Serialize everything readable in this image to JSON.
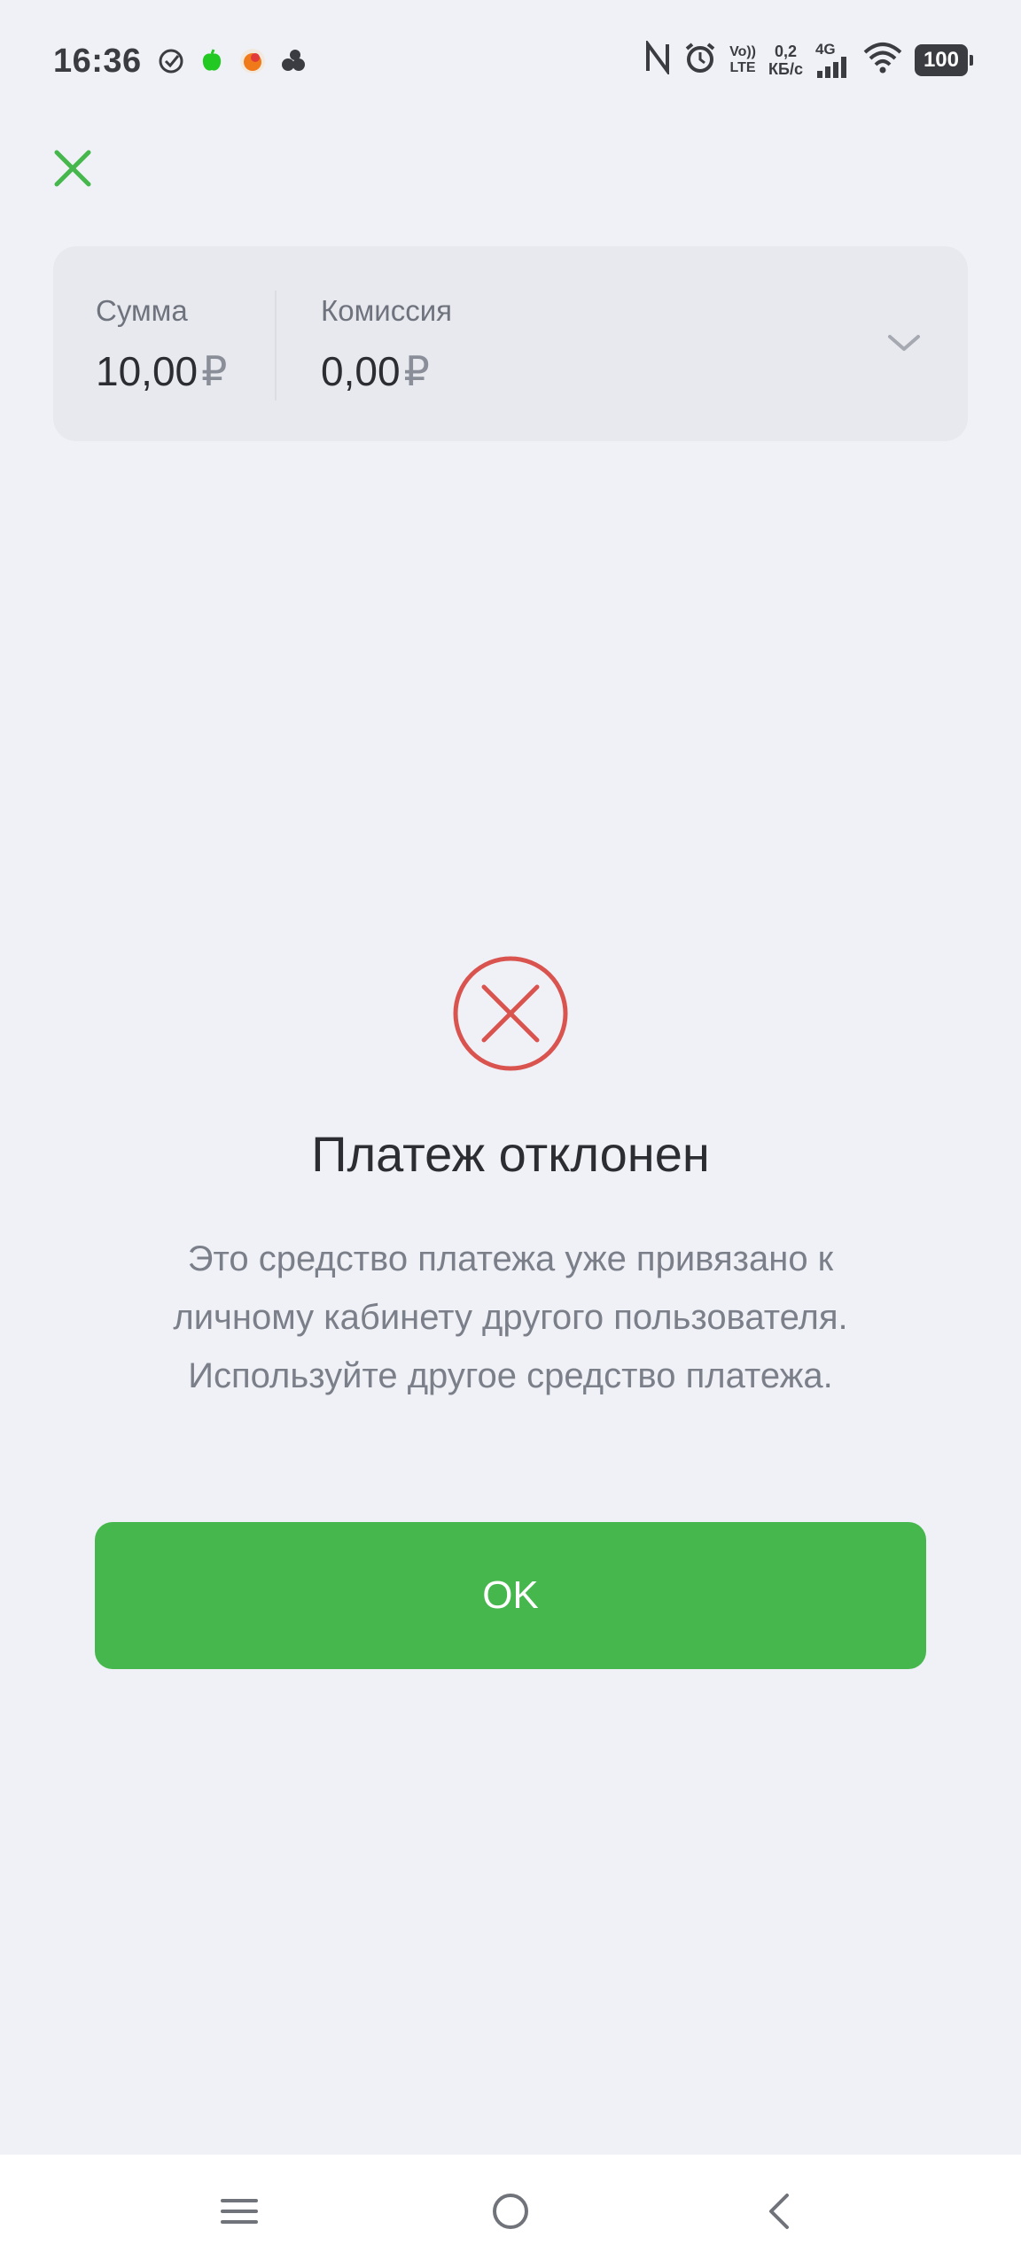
{
  "status_bar": {
    "time": "16:36",
    "network_speed_value": "0,2",
    "network_speed_unit": "КБ/с",
    "volte_top": "Vo))",
    "volte_bottom": "LTE",
    "signal_type": "4G",
    "battery": "100"
  },
  "summary": {
    "amount_label": "Сумма",
    "amount_value": "10,00",
    "fee_label": "Комиссия",
    "fee_value": "0,00",
    "currency_symbol": "₽"
  },
  "result": {
    "title": "Платеж отклонен",
    "message": "Это средство платежа уже привязано к личному кабинету другого пользователя. Используйте другое средство платежа.",
    "ok_label": "OK"
  },
  "colors": {
    "accent_green": "#45b74d",
    "error_red": "#d9534f",
    "background": "#f0f1f6"
  }
}
